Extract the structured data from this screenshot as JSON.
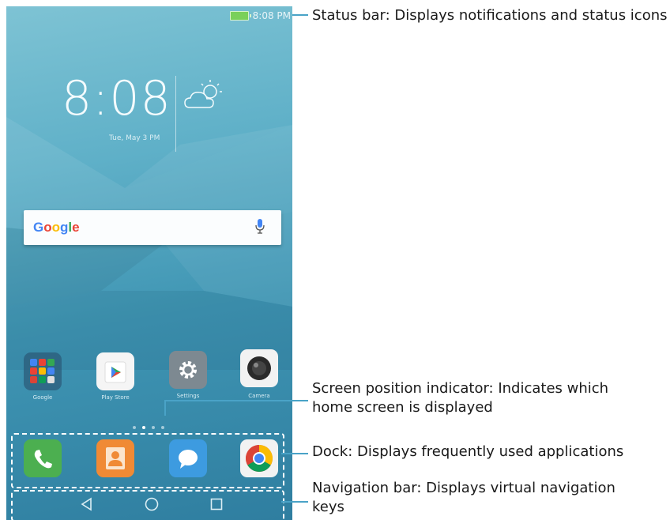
{
  "status_bar": {
    "time": "8:08 PM"
  },
  "lockscreen": {
    "clock": "8:08",
    "date": "Tue, May 3 PM"
  },
  "search_bar": {
    "logo": "Google"
  },
  "apps": [
    {
      "label": "Google"
    },
    {
      "label": "Play Store"
    },
    {
      "label": "Settings"
    },
    {
      "label": "Camera"
    }
  ],
  "dock": [
    {
      "name": "Phone"
    },
    {
      "name": "Contacts"
    },
    {
      "name": "Messaging"
    },
    {
      "name": "Chrome"
    }
  ],
  "annotations": {
    "status_bar": "Status bar: Displays notifications and status icons",
    "screen_indicator": "Screen position indicator: Indicates which home screen is displayed",
    "dock": "Dock: Displays frequently used applications",
    "navigation_bar": "Navigation bar: Displays virtual navigation keys"
  },
  "colors": {
    "leader": "#4aa3c7",
    "phone_bg": "#4fa3c0"
  }
}
